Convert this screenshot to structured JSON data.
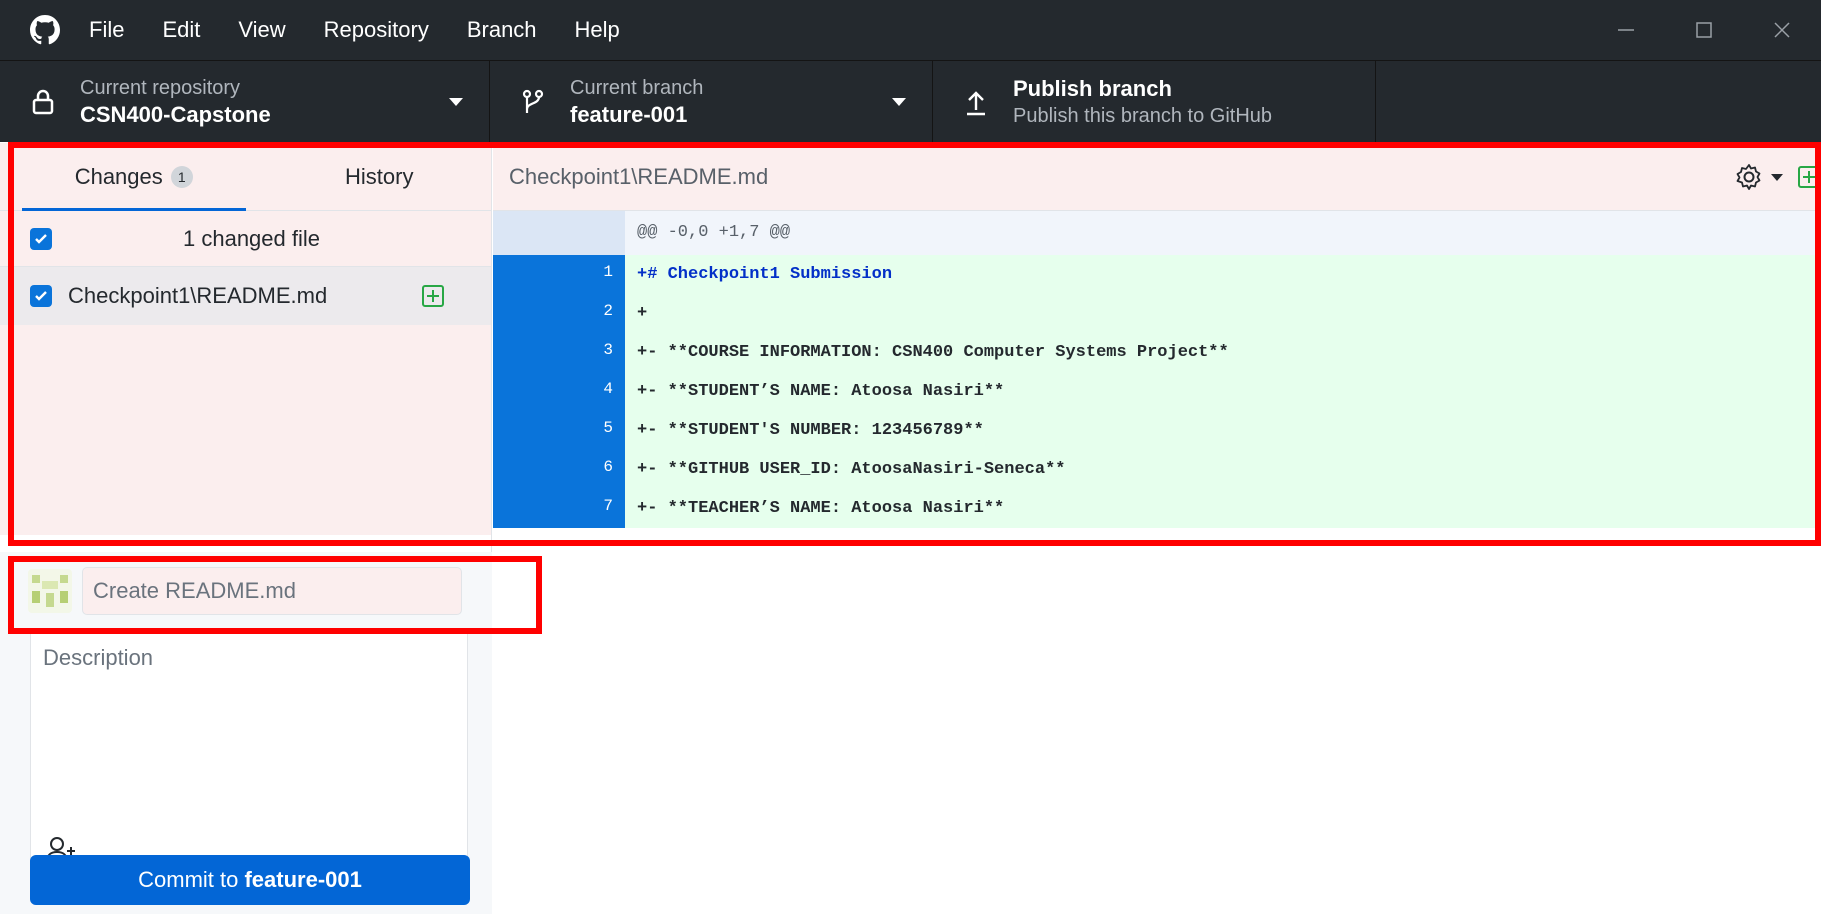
{
  "menu": {
    "items": [
      "File",
      "Edit",
      "View",
      "Repository",
      "Branch",
      "Help"
    ]
  },
  "toolbar": {
    "repository": {
      "label": "Current repository",
      "value": "CSN400-Capstone"
    },
    "branch": {
      "label": "Current branch",
      "value": "feature-001"
    },
    "publish": {
      "title": "Publish branch",
      "subtitle": "Publish this branch to GitHub"
    }
  },
  "sidebar": {
    "tabs": [
      {
        "label": "Changes",
        "badge": "1"
      },
      {
        "label": "History"
      }
    ],
    "changed_count": "1 changed file",
    "files": [
      {
        "name": "Checkpoint1\\README.md",
        "status": "added"
      }
    ]
  },
  "commit": {
    "summary_value": "",
    "summary_placeholder": "Create README.md",
    "description_placeholder": "Description",
    "button_prefix": "Commit to ",
    "button_branch": "feature-001"
  },
  "diff": {
    "path": "Checkpoint1\\README.md",
    "hunk": "@@ -0,0 +1,7 @@",
    "lines": [
      {
        "num": "1",
        "text": "+# Checkpoint1 Submission"
      },
      {
        "num": "2",
        "text": "+"
      },
      {
        "num": "3",
        "text": "+- **COURSE INFORMATION: CSN400 Computer Systems Project**"
      },
      {
        "num": "4",
        "text": "+- **STUDENT’S NAME: Atoosa Nasiri**"
      },
      {
        "num": "5",
        "text": "+- **STUDENT'S NUMBER: 123456789**"
      },
      {
        "num": "6",
        "text": "+- **GITHUB USER_ID: AtoosaNasiri-Seneca**"
      },
      {
        "num": "7",
        "text": "+- **TEACHER’S NAME: Atoosa Nasiri**"
      }
    ]
  },
  "colors": {
    "accent": "#0366d6",
    "highlight": "#ff0000",
    "added_background": "#e6ffed"
  }
}
